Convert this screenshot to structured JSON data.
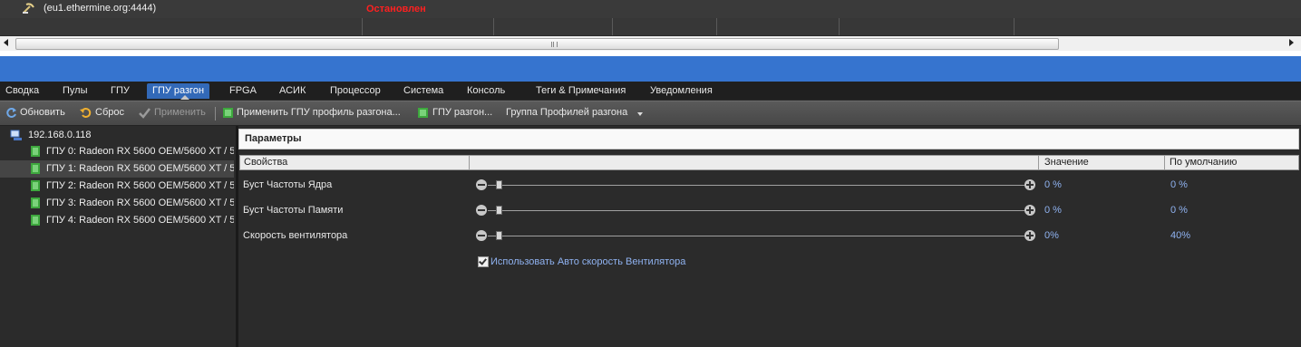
{
  "pool": {
    "text": "(eu1.ethermine.org:4444)",
    "status": "Остановлен"
  },
  "tabs": [
    {
      "label": "Сводка"
    },
    {
      "label": "Пулы"
    },
    {
      "label": "ГПУ"
    },
    {
      "label": "ГПУ разгон"
    },
    {
      "label": "FPGA"
    },
    {
      "label": "АСИК"
    },
    {
      "label": "Процессор"
    },
    {
      "label": "Система"
    },
    {
      "label": "Консоль"
    },
    {
      "label": "Теги & Примечания"
    },
    {
      "label": "Уведомления"
    }
  ],
  "active_tab": "ГПУ разгон",
  "toolbar": {
    "refresh": "Обновить",
    "reset": "Сброс",
    "apply": "Применить",
    "apply_profile": "Применить ГПУ профиль разгона...",
    "gpu_oc": "ГПУ разгон...",
    "profile_group": "Группа Профилей разгона"
  },
  "tree": {
    "host": "192.168.0.118",
    "gpus": [
      {
        "label": "ГПУ 0: Radeon RX 5600 OEM/5600 XT / 5"
      },
      {
        "label": "ГПУ 1: Radeon RX 5600 OEM/5600 XT / 5"
      },
      {
        "label": "ГПУ 2: Radeon RX 5600 OEM/5600 XT / 5"
      },
      {
        "label": "ГПУ 3: Radeon RX 5600 OEM/5600 XT / 5"
      },
      {
        "label": "ГПУ 4: Radeon RX 5600 OEM/5600 XT / 5"
      }
    ],
    "selected_index": 1
  },
  "panel": {
    "title": "Параметры",
    "columns": {
      "properties": "Свойства",
      "value": "Значение",
      "default": "По умолчанию"
    },
    "rows": [
      {
        "name": "Буст Частоты Ядра",
        "value": "0 %",
        "default": "0 %",
        "slider_level": 0.02
      },
      {
        "name": "Буст Частоты Памяти",
        "value": "0 %",
        "default": "0 %",
        "slider_level": 0.02
      },
      {
        "name": "Скорость вентилятора",
        "value": "0%",
        "default": "40%",
        "slider_level": 0.02
      }
    ],
    "auto_fan_label": "Использовать Авто скорость Вентилятора",
    "auto_fan_checked": true
  },
  "colors": {
    "accent": "#3674cf",
    "status_stopped": "#ff2020",
    "value_text": "#8fb2f0"
  }
}
